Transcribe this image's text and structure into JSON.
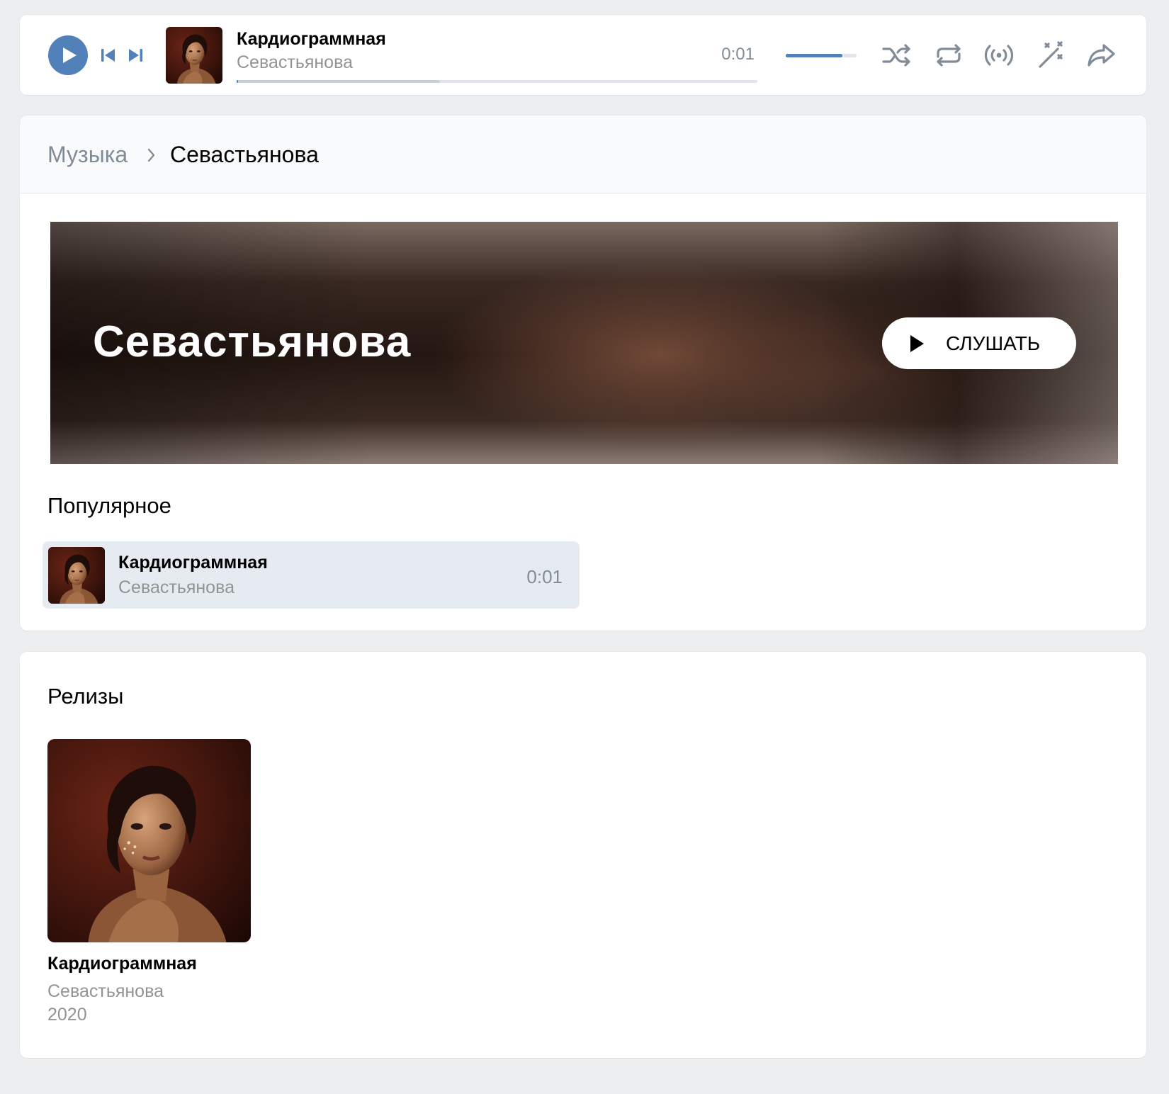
{
  "player": {
    "track_title": "Кардиограммная",
    "track_artist": "Севастьянова",
    "time": "0:01",
    "progress_fraction": 0.003,
    "buffered_fraction": 0.39,
    "volume_fraction": 0.8,
    "icons": [
      "play-icon",
      "previous-icon",
      "next-icon",
      "shuffle-icon",
      "repeat-icon",
      "broadcast-icon",
      "magic-wand-icon",
      "share-icon"
    ]
  },
  "breadcrumb": {
    "parent": "Музыка",
    "current": "Севастьянова"
  },
  "banner": {
    "artist_name": "Севастьянова",
    "listen_label": "СЛУШАТЬ"
  },
  "popular": {
    "title": "Популярное",
    "tracks": [
      {
        "title": "Кардиограммная",
        "artist": "Севастьянова",
        "duration": "0:01"
      }
    ]
  },
  "releases": {
    "title": "Релизы",
    "items": [
      {
        "title": "Кардиограммная",
        "artist": "Севастьянова",
        "year": "2020"
      }
    ]
  },
  "colors": {
    "accent": "#5181b8",
    "page_bg": "#edeef0",
    "secondary_text": "#939393",
    "muted_text": "#818c99",
    "row_highlight": "#e6ebf1"
  }
}
